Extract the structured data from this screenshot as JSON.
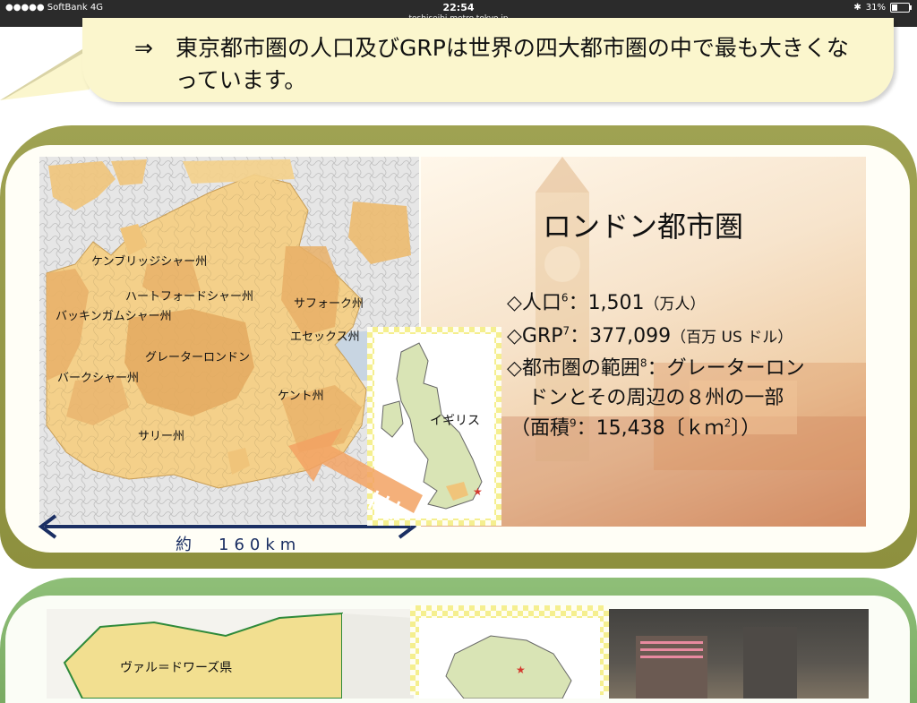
{
  "status_bar": {
    "carrier": "●●●●● SoftBank  4G",
    "time": "22:54",
    "url": "toshiseibi.metro.tokyo.jp",
    "battery": "31%",
    "battery_level": 0.31
  },
  "bubble": {
    "arrow": "⇒",
    "line1": "東京都市圏の人口及びGRPは世界の四大都市圏の中で最も大きくな",
    "line2": "っています。"
  },
  "london": {
    "title": "ロンドン都市圏",
    "population": {
      "label": "◇人口",
      "sup": "6",
      "value": "：1,501",
      "unit": "（万人）"
    },
    "grp": {
      "label": "◇GRP",
      "sup": "7",
      "value": "：377,099",
      "unit": "（百万 US ドル）"
    },
    "range": {
      "label": "◇都市圏の範囲",
      "sup": "8",
      "value": "：グレーターロン",
      "line2": "ドンとその周辺の８州の一部",
      "line3_pre": "（面積",
      "line3_sup": "9",
      "line3_val": "：15,438〔ｋｍ",
      "line3_sup2": "2",
      "line3_end": "〕）"
    },
    "map_labels": {
      "cambridge": "ケンブリッジシャー州",
      "hertford": "ハートフォードシャー州",
      "bucking": "バッキンガムシャー州",
      "suffolk": "サフォーク州",
      "essex": "エセックス州",
      "greater": "グレーターロンドン",
      "berk": "バークシャー州",
      "kent": "ケント州",
      "surrey": "サリー州"
    },
    "inset_label": "イギリス",
    "scale": "約　160km"
  },
  "paris": {
    "map_label": "ヴァル＝ドワーズ県"
  },
  "colors": {
    "map_fill": "#f4d08a",
    "map_dark": "#e9b267",
    "scale_arrow": "#1b2f63",
    "arrow_orange": "#f2a263",
    "band_olive": "#9a9d4c",
    "band_green": "#86b46c"
  }
}
